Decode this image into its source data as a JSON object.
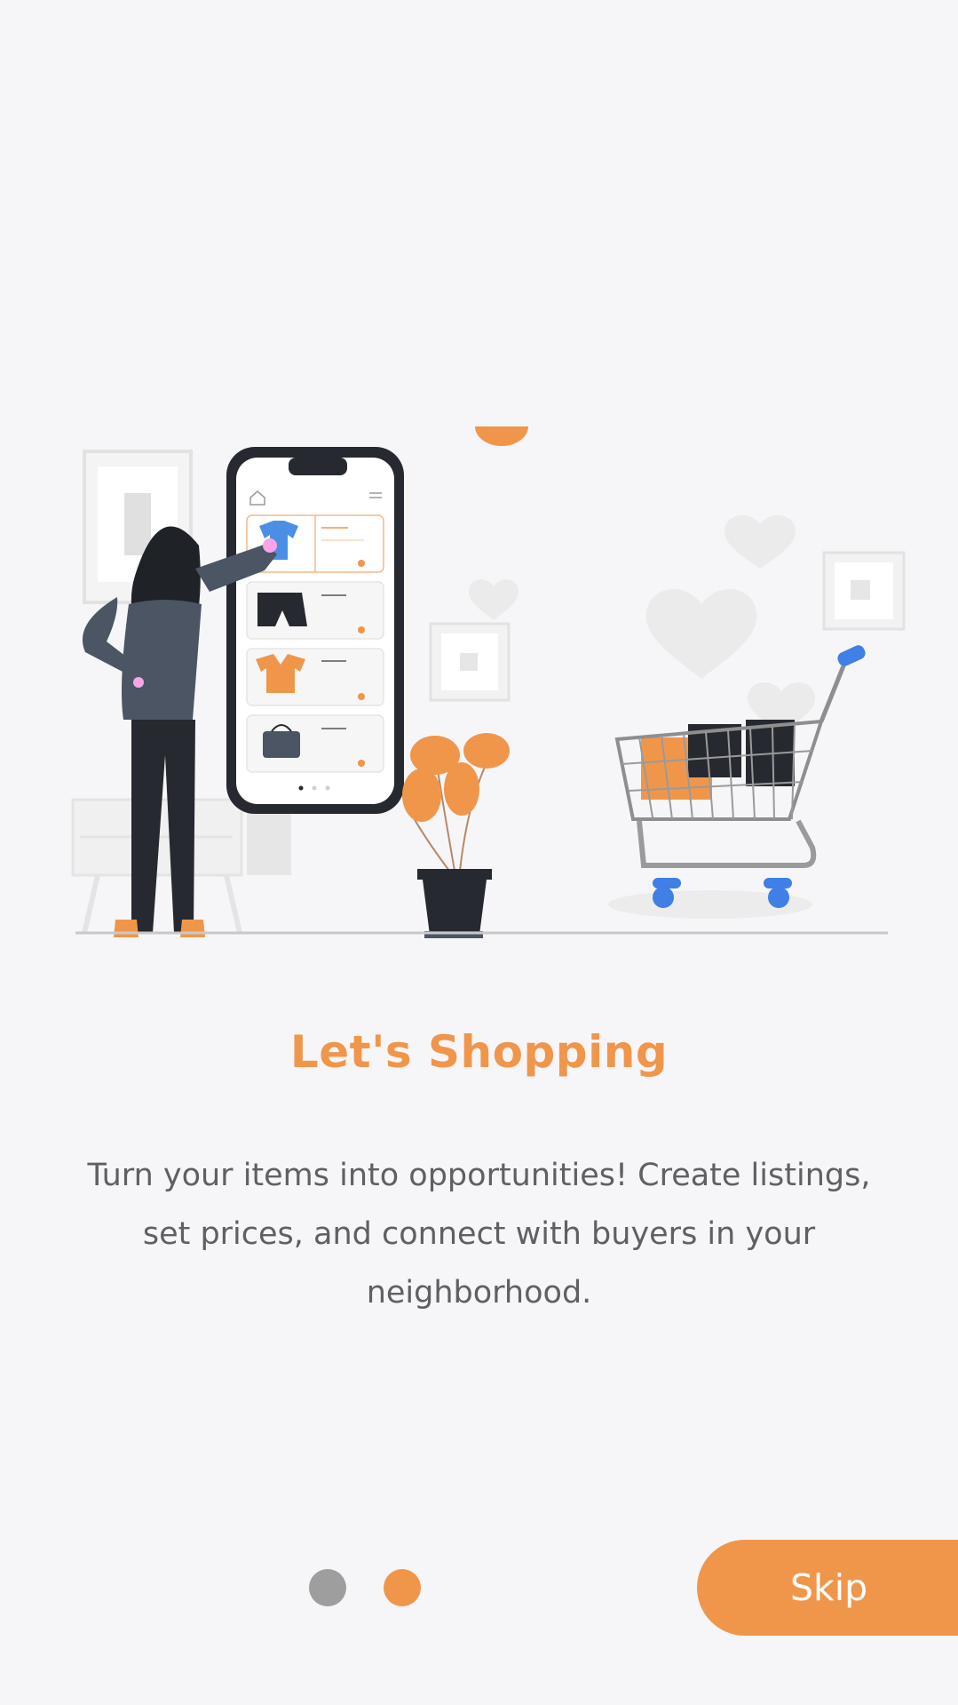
{
  "onboarding": {
    "title": "Let's Shopping",
    "description": "Turn your items into opportunities! Create listings, set prices, and connect with buyers in your neighborhood."
  },
  "pagination": {
    "total": 2,
    "current": 2
  },
  "actions": {
    "skip_label": "Skip"
  },
  "colors": {
    "accent": "#f0964b",
    "background": "#f6f6f9",
    "text": "#5f6064",
    "dot_inactive": "#9e9e9e"
  },
  "illustration": {
    "icons": [
      "woman-figure",
      "smartphone",
      "tshirt-icon",
      "shorts-icon",
      "jacket-icon",
      "bag-icon",
      "plant-icon",
      "shopping-cart-icon",
      "heart-icon",
      "picture-frame-icon"
    ]
  }
}
